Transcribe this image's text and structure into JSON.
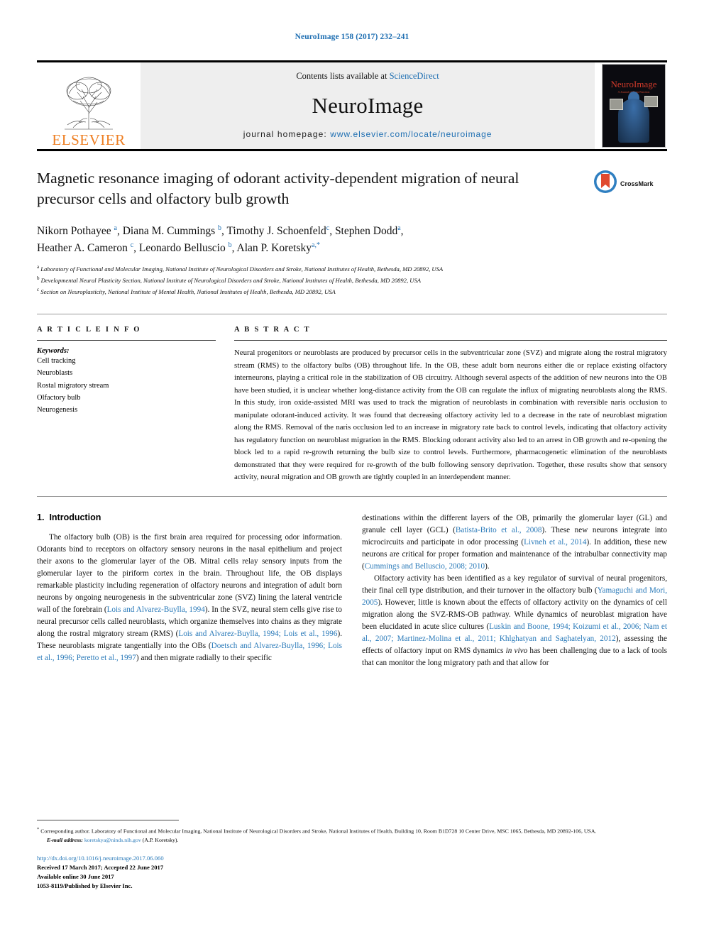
{
  "running_head": "NeuroImage 158 (2017) 232–241",
  "masthead": {
    "publisher_name": "ELSEVIER",
    "contents_prefix": "Contents lists available at ",
    "contents_link": "ScienceDirect",
    "journal_title": "NeuroImage",
    "homepage_label": "journal homepage: ",
    "homepage_url": "www.elsevier.com/locate/neuroimage",
    "cover_title": "NeuroImage",
    "cover_subtitle": "A Journal of Brain Function"
  },
  "article": {
    "title": "Magnetic resonance imaging of odorant activity-dependent migration of neural precursor cells and olfactory bulb growth",
    "crossmark_label": "CrossMark",
    "authors_line_1": "Nikorn Pothayee a, Diana M. Cummings b, Timothy J. Schoenfeld c, Stephen Dodd a,",
    "authors_line_2": "Heather A. Cameron c, Leonardo Belluscio b, Alan P. Koretsky a,*",
    "authors": [
      {
        "name": "Nikorn Pothayee",
        "sup": "a"
      },
      {
        "name": "Diana M. Cummings",
        "sup": "b"
      },
      {
        "name": "Timothy J. Schoenfeld",
        "sup": "c"
      },
      {
        "name": "Stephen Dodd",
        "sup": "a"
      },
      {
        "name": "Heather A. Cameron",
        "sup": "c"
      },
      {
        "name": "Leonardo Belluscio",
        "sup": "b"
      },
      {
        "name": "Alan P. Koretsky",
        "sup": "a,*"
      }
    ],
    "affiliations": [
      {
        "sup": "a",
        "text": "Laboratory of Functional and Molecular Imaging, National Institute of Neurological Disorders and Stroke, National Institutes of Health, Bethesda, MD 20892, USA"
      },
      {
        "sup": "b",
        "text": "Developmental Neural Plasticity Section, National Institute of Neurological Disorders and Stroke, National Institutes of Health, Bethesda, MD 20892, USA"
      },
      {
        "sup": "c",
        "text": "Section on Neuroplasticity, National Institute of Mental Health, National Institutes of Health, Bethesda, MD 20892, USA"
      }
    ]
  },
  "article_info": {
    "heading": "A R T I C L E   I N F O",
    "keywords_label": "Keywords:",
    "keywords": [
      "Cell tracking",
      "Neuroblasts",
      "Rostal migratory stream",
      "Olfactory bulb",
      "Neurogenesis"
    ]
  },
  "abstract": {
    "heading": "A B S T R A C T",
    "text": "Neural progenitors or neuroblasts are produced by precursor cells in the subventricular zone (SVZ) and migrate along the rostral migratory stream (RMS) to the olfactory bulbs (OB) throughout life. In the OB, these adult born neurons either die or replace existing olfactory interneurons, playing a critical role in the stabilization of OB circuitry. Although several aspects of the addition of new neurons into the OB have been studied, it is unclear whether long-distance activity from the OB can regulate the influx of migrating neuroblasts along the RMS. In this study, iron oxide-assisted MRI was used to track the migration of neuroblasts in combination with reversible naris occlusion to manipulate odorant-induced activity. It was found that decreasing olfactory activity led to a decrease in the rate of neuroblast migration along the RMS. Removal of the naris occlusion led to an increase in migratory rate back to control levels, indicating that olfactory activity has regulatory function on neuroblast migration in the RMS. Blocking odorant activity also led to an arrest in OB growth and re-opening the block led to a rapid re-growth returning the bulb size to control levels. Furthermore, pharmacogenetic elimination of the neuroblasts demonstrated that they were required for re-growth of the bulb following sensory deprivation. Together, these results show that sensory activity, neural migration and OB growth are tightly coupled in an interdependent manner."
  },
  "introduction": {
    "number": "1.",
    "heading": "Introduction",
    "left_para_1_a": "The olfactory bulb (OB) is the first brain area required for processing odor information. Odorants bind to receptors on olfactory sensory neurons in the nasal epithelium and project their axons to the glomerular layer of the OB. Mitral cells relay sensory inputs from the glomerular layer to the piriform cortex in the brain. Throughout life, the OB displays remarkable plasticity including regeneration of olfactory neurons and integration of adult born neurons by ongoing neurogenesis in the subventricular zone (SVZ) lining the lateral ventricle wall of the forebrain (",
    "ref_1": "Lois and Alvarez-Buylla, 1994",
    "left_para_1_b": "). In the SVZ, neural stem cells give rise to neural precursor cells called neuroblasts, which organize themselves into chains as they migrate along the rostral migratory stream (RMS) (",
    "ref_2": "Lois and Alvarez-Buylla, 1994; Lois et al., 1996",
    "left_para_1_c": "). These neuroblasts migrate tangentially into the OBs (",
    "ref_3": "Doetsch and Alvarez-Buylla, 1996; Lois et al., 1996; Peretto et al., 1997",
    "left_para_1_d": ") and then migrate radially to their specific",
    "right_para_1_a": "destinations within the different layers of the OB, primarily the glomerular layer (GL) and granule cell layer (GCL) (",
    "ref_4": "Batista-Brito et al., 2008",
    "right_para_1_b": "). These new neurons integrate into microcircuits and participate in odor processing (",
    "ref_5": "Livneh et al., 2014",
    "right_para_1_c": "). In addition, these new neurons are critical for proper formation and maintenance of the intrabulbar connectivity map (",
    "ref_6": "Cummings and Belluscio, 2008; 2010",
    "right_para_1_d": ").",
    "right_para_2_a": "Olfactory activity has been identified as a key regulator of survival of neural progenitors, their final cell type distribution, and their turnover in the olfactory bulb (",
    "ref_7": "Yamaguchi and Mori, 2005",
    "right_para_2_b": "). However, little is known about the effects of olfactory activity on the dynamics of cell migration along the SVZ-RMS-OB pathway. While dynamics of neuroblast migration have been elucidated in acute slice cultures (",
    "ref_8": "Luskin and Boone, 1994; Koizumi et al., 2006; Nam et al., 2007; Martinez-Molina et al., 2011; Khlghatyan and Saghatelyan, 2012",
    "right_para_2_c": "), assessing the effects of olfactory input on RMS dynamics ",
    "italic_1": "in vivo",
    "right_para_2_d": " has been challenging due to a lack of tools that can monitor the long migratory path and that allow for"
  },
  "footnotes": {
    "corresponding": "Corresponding author. Laboratory of Functional and Molecular Imaging, National Institute of Neurological Disorders and Stroke, National Institutes of Health, Building 10, Room B1D728 10 Center Drive, MSC 1065, Bethesda, MD 20892-106, USA.",
    "corresponding_marker": "*",
    "email_label": "E-mail address:",
    "email_address": "koretskya@ninds.nih.gov",
    "email_suffix": "(A.P. Koretsky)."
  },
  "publication": {
    "doi": "http://dx.doi.org/10.1016/j.neuroimage.2017.06.060",
    "received": "Received 17 March 2017; Accepted 22 June 2017",
    "available": "Available online 30 June 2017",
    "issn_line": "1053-8119/Published by Elsevier Inc."
  },
  "colors": {
    "link_blue": "#2a7ab9",
    "header_blue": "#1f6fb2",
    "elsevier_orange": "#ee7f23",
    "crossmark_red": "#e04a2f"
  }
}
